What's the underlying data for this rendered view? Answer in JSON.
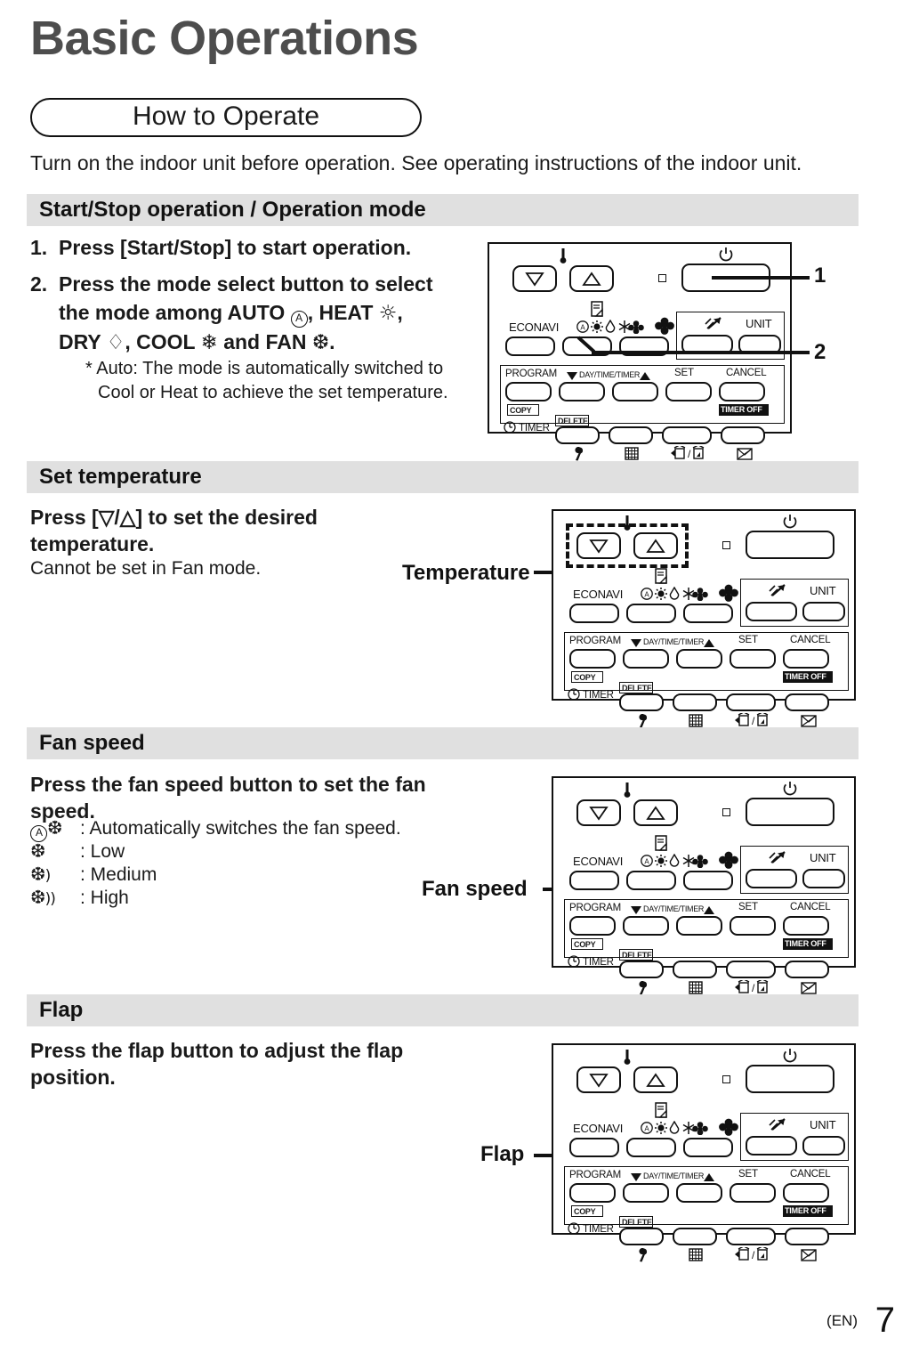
{
  "page": {
    "title": "Basic Operations",
    "pill_label": "How to Operate",
    "intro": "Turn on the indoor unit before operation. See operating instructions of the indoor unit.",
    "footer_lang": "(EN)",
    "footer_page": "7"
  },
  "sections": [
    {
      "id": "start-stop",
      "header": "Start/Stop operation / Operation mode",
      "step1_num": "1.",
      "step1_text": "Press [Start/Stop] to start operation.",
      "step2_num": "2.",
      "step2_line1": "Press the mode select button to select",
      "step2_line2_a": "the mode among AUTO",
      "step2_line2_b": ", HEAT",
      "step2_line2_c": ",",
      "step2_line3_a": "DRY",
      "step2_line3_b": ", COOL",
      "step2_line3_c": "and FAN",
      "step2_line3_d": ".",
      "note": "* Auto: The mode is automatically switched to Cool or Heat to achieve the set temperature.",
      "callout_1": "1",
      "callout_2": "2"
    },
    {
      "id": "set-temperature",
      "header": "Set temperature",
      "line1": "Press [▽/△] to set the desired",
      "line2": "temperature.",
      "line3": "Cannot be set in Fan mode.",
      "callout": "Temperature"
    },
    {
      "id": "fan-speed",
      "header": "Fan speed",
      "line1": "Press the fan speed button to set the fan",
      "line2": "speed.",
      "legend": [
        {
          "symbol": "auto-fan",
          "text": ": Automatically switches the fan speed."
        },
        {
          "symbol": "fan-low",
          "text": ": Low"
        },
        {
          "symbol": "fan-medium",
          "text": ": Medium"
        },
        {
          "symbol": "fan-high",
          "text": ": High"
        }
      ],
      "callout": "Fan speed"
    },
    {
      "id": "flap",
      "header": "Flap",
      "line1": "Press the flap button to adjust the flap",
      "line2": "position.",
      "callout": "Flap"
    }
  ],
  "remote": {
    "labels": {
      "econavi": "ECONAVI",
      "unit": "UNIT",
      "program": "PROGRAM",
      "day_time_timer": "DAY/TIME/TIMER",
      "set": "SET",
      "cancel": "CANCEL",
      "copy": "COPY",
      "delete": "DELETE",
      "timer_off": "TIMER OFF",
      "timer": "TIMER"
    },
    "icons": {
      "thermometer": "thermometer-icon",
      "power": "power-icon",
      "led": "led-indicator",
      "mode_auto": "auto-mode-icon",
      "mode_heat": "heat-mode-icon",
      "mode_dry": "dry-mode-icon",
      "mode_cool": "cool-mode-icon",
      "mode_fan": "fan-mode-icon",
      "fan_speed": "fan-speed-icon",
      "flap": "flap-icon",
      "ventilation": "ventilation-icon",
      "filter": "filter-icon",
      "wrench": "wrench-icon",
      "grid": "grid-icon",
      "home_away": "home-away-icon",
      "mail": "mail-icon",
      "clock": "clock-icon"
    },
    "mode_glyphs": {
      "heat": "☀",
      "dry": "💧",
      "cool": "❄",
      "fan": "❁"
    }
  },
  "colors": {
    "section_bar": "#e0e0e0",
    "title": "#4d4d4d",
    "text": "#1a1a1a",
    "outline": "#111111"
  }
}
